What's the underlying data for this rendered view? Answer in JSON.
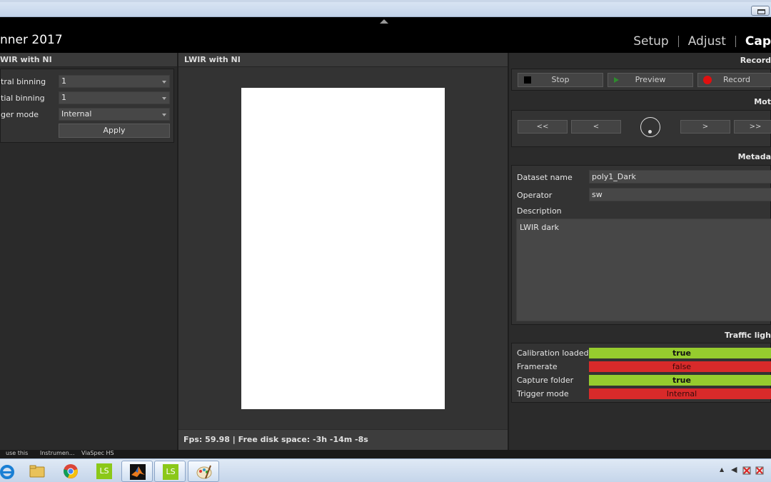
{
  "app": {
    "title": "nner 2017",
    "nav": [
      {
        "label": "Setup",
        "active": false
      },
      {
        "label": "Adjust",
        "active": false
      },
      {
        "label": "Cap",
        "active": true
      }
    ]
  },
  "left_panel": {
    "header": "WIR with NI",
    "settings": [
      {
        "label": "tral binning",
        "value": "1"
      },
      {
        "label": "tial binning",
        "value": "1"
      },
      {
        "label": "ger mode",
        "value": "Internal"
      }
    ],
    "apply_label": "Apply"
  },
  "center_panel": {
    "header": "LWIR with NI",
    "status": "Fps: 59.98 | Free disk space: -3h -14m -8s"
  },
  "right_panel": {
    "record": {
      "header": "Record",
      "stop_label": "Stop",
      "preview_label": "Preview",
      "record_label": "Record"
    },
    "motion": {
      "header": "Mot",
      "buttons": [
        "<<",
        "<",
        ">",
        ">>"
      ]
    },
    "metadata": {
      "header": "Metada",
      "dataset_label": "Dataset name",
      "dataset_value": "poly1_Dark",
      "operator_label": "Operator",
      "operator_value": "sw",
      "description_label": "Description",
      "description_value": "LWIR dark"
    },
    "traffic": {
      "header": "Traffic ligh",
      "rows": [
        {
          "label": "Calibration loaded",
          "value": "true",
          "state": "ok"
        },
        {
          "label": "Framerate",
          "value": "false",
          "state": "error"
        },
        {
          "label": "Capture folder",
          "value": "true",
          "state": "ok"
        },
        {
          "label": "Trigger mode",
          "value": "Internal",
          "state": "error"
        }
      ]
    }
  },
  "taskbar": {
    "strip_labels": [
      "use this",
      "Instrumen...",
      "ViaSpec HS"
    ],
    "apps": [
      {
        "icon": "ie-icon"
      },
      {
        "icon": "folder-icon"
      },
      {
        "icon": "chrome-icon"
      },
      {
        "icon": "ls-icon",
        "text": "LS"
      },
      {
        "icon": "matlab-icon"
      },
      {
        "icon": "ls-icon",
        "text": "LS"
      },
      {
        "icon": "paint-icon"
      }
    ]
  },
  "colors": {
    "ok": "#96cc2e",
    "error": "#d82a2a"
  }
}
